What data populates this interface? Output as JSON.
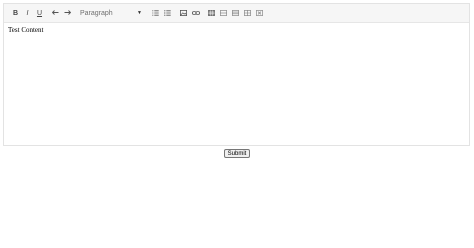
{
  "toolbar": {
    "bold_label": "B",
    "italic_label": "I",
    "underline_label": "U",
    "format_select": {
      "value": "Paragraph"
    },
    "icons": [
      "undo-icon",
      "redo-icon",
      "numbered-list-icon",
      "bulleted-list-icon",
      "image-icon",
      "link-icon",
      "table-icon",
      "table-row-icon",
      "table-column-icon",
      "table-cell-icon",
      "table-delete-icon"
    ]
  },
  "editor": {
    "content": "Test Content"
  },
  "form": {
    "submit_label": "Submit"
  }
}
